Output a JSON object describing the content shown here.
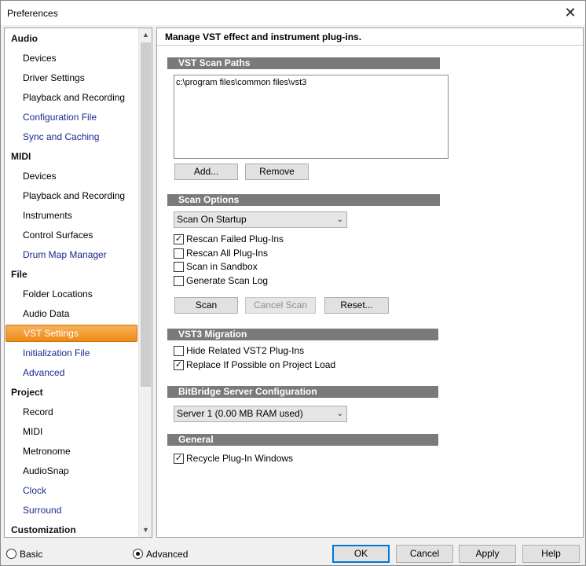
{
  "window": {
    "title": "Preferences",
    "close_glyph": "✕"
  },
  "sidebar": {
    "categories": [
      {
        "label": "Audio",
        "items": [
          {
            "label": "Devices",
            "style": "normal"
          },
          {
            "label": "Driver Settings",
            "style": "normal"
          },
          {
            "label": "Playback and Recording",
            "style": "normal"
          },
          {
            "label": "Configuration File",
            "style": "link"
          },
          {
            "label": "Sync and Caching",
            "style": "link"
          }
        ]
      },
      {
        "label": "MIDI",
        "items": [
          {
            "label": "Devices",
            "style": "normal"
          },
          {
            "label": "Playback and Recording",
            "style": "normal"
          },
          {
            "label": "Instruments",
            "style": "normal"
          },
          {
            "label": "Control Surfaces",
            "style": "normal"
          },
          {
            "label": "Drum Map Manager",
            "style": "link"
          }
        ]
      },
      {
        "label": "File",
        "items": [
          {
            "label": "Folder Locations",
            "style": "normal"
          },
          {
            "label": "Audio Data",
            "style": "normal"
          },
          {
            "label": "VST Settings",
            "style": "selected"
          },
          {
            "label": "Initialization File",
            "style": "link"
          },
          {
            "label": "Advanced",
            "style": "link"
          }
        ]
      },
      {
        "label": "Project",
        "items": [
          {
            "label": "Record",
            "style": "normal"
          },
          {
            "label": "MIDI",
            "style": "normal"
          },
          {
            "label": "Metronome",
            "style": "normal"
          },
          {
            "label": "AudioSnap",
            "style": "normal"
          },
          {
            "label": "Clock",
            "style": "link"
          },
          {
            "label": "Surround",
            "style": "link"
          }
        ]
      },
      {
        "label": "Customization",
        "items": []
      }
    ],
    "scroll_up_glyph": "▲",
    "scroll_down_glyph": "▼"
  },
  "main": {
    "heading": "Manage VST effect and instrument plug-ins.",
    "scan_paths": {
      "title": "VST Scan Paths",
      "paths": [
        "c:\\program files\\common files\\vst3"
      ],
      "add_label": "Add...",
      "remove_label": "Remove"
    },
    "scan_options": {
      "title": "Scan Options",
      "mode_value": "Scan On Startup",
      "checkboxes": [
        {
          "label": "Rescan Failed Plug-Ins",
          "checked": true
        },
        {
          "label": "Rescan All Plug-Ins",
          "checked": false
        },
        {
          "label": "Scan in Sandbox",
          "checked": false
        },
        {
          "label": "Generate Scan Log",
          "checked": false
        }
      ],
      "scan_label": "Scan",
      "cancel_scan_label": "Cancel Scan",
      "reset_label": "Reset..."
    },
    "vst3_migration": {
      "title": "VST3 Migration",
      "checkboxes": [
        {
          "label": "Hide Related VST2 Plug-Ins",
          "checked": false
        },
        {
          "label": "Replace If Possible on Project Load",
          "checked": true
        }
      ]
    },
    "bitbridge": {
      "title": "BitBridge Server Configuration",
      "server_value": "Server 1  (0.00  MB RAM used)"
    },
    "general": {
      "title": "General",
      "checkboxes": [
        {
          "label": "Recycle Plug-In Windows",
          "checked": true
        }
      ]
    }
  },
  "footer": {
    "mode_basic_label": "Basic",
    "mode_advanced_label": "Advanced",
    "mode_selected": "Advanced",
    "ok_label": "OK",
    "cancel_label": "Cancel",
    "apply_label": "Apply",
    "help_label": "Help"
  },
  "icons": {
    "check_glyph": "✓",
    "dropdown_arrow_glyph": "⌄"
  }
}
